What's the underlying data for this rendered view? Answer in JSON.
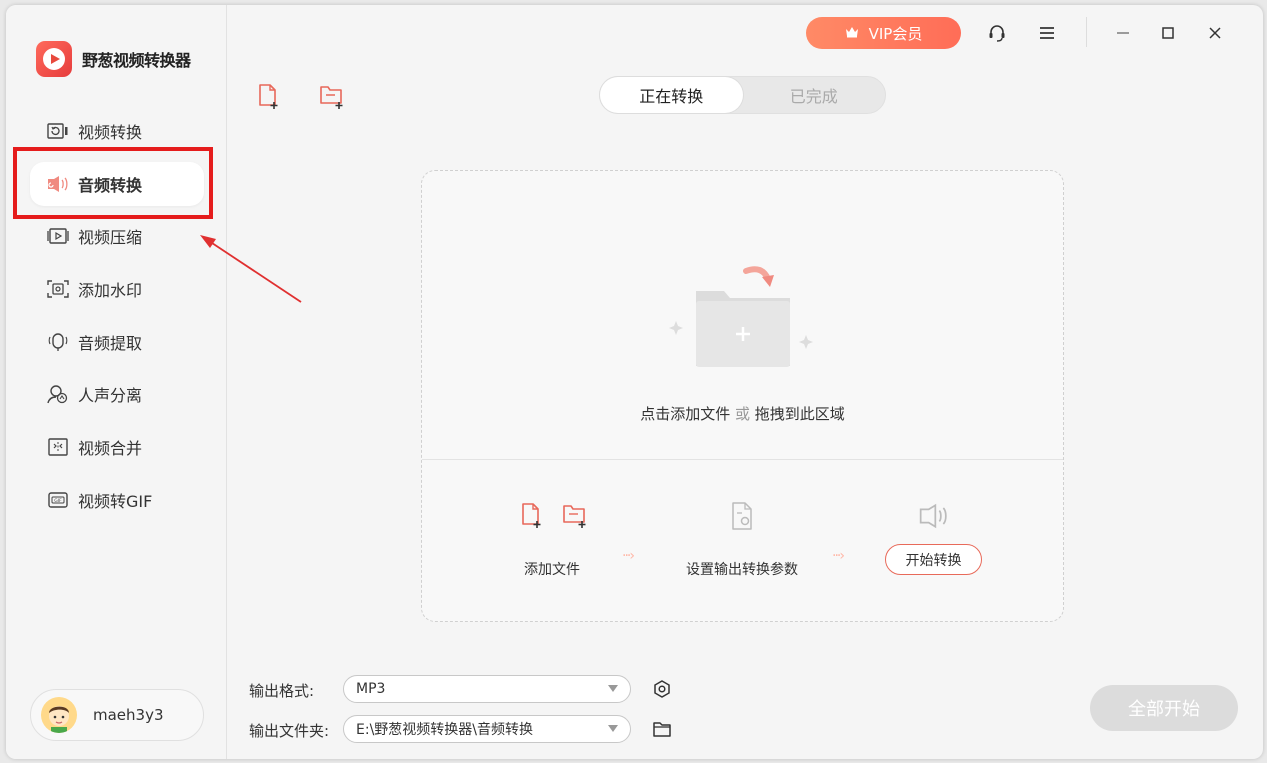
{
  "app": {
    "title": "野葱视频转换器"
  },
  "sidebar": {
    "items": [
      {
        "label": "视频转换",
        "icon": "video-convert-icon"
      },
      {
        "label": "音频转换",
        "icon": "audio-convert-icon",
        "active": true
      },
      {
        "label": "视频压缩",
        "icon": "video-compress-icon"
      },
      {
        "label": "添加水印",
        "icon": "watermark-icon"
      },
      {
        "label": "音频提取",
        "icon": "audio-extract-icon"
      },
      {
        "label": "人声分离",
        "icon": "vocal-separate-icon"
      },
      {
        "label": "视频合并",
        "icon": "video-merge-icon"
      },
      {
        "label": "视频转GIF",
        "icon": "gif-icon"
      }
    ]
  },
  "user": {
    "name": "maeh3y3"
  },
  "topbar": {
    "vip_label": "VIP会员"
  },
  "tabs": [
    {
      "label": "正在转换",
      "active": true
    },
    {
      "label": "已完成",
      "active": false
    }
  ],
  "drop_area": {
    "hint_main": "点击添加文件",
    "hint_or": "或",
    "hint_drag": "拖拽到此区域",
    "steps": {
      "add_files": "添加文件",
      "set_params": "设置输出转换参数",
      "start": "开始转换"
    }
  },
  "output": {
    "format_label": "输出格式:",
    "format_value": "MP3",
    "folder_label": "输出文件夹:",
    "folder_value": "E:\\野葱视频转换器\\音频转换"
  },
  "start_all_label": "全部开始",
  "colors": {
    "accent": "#ff6d57",
    "highlight": "#e51c1c"
  }
}
